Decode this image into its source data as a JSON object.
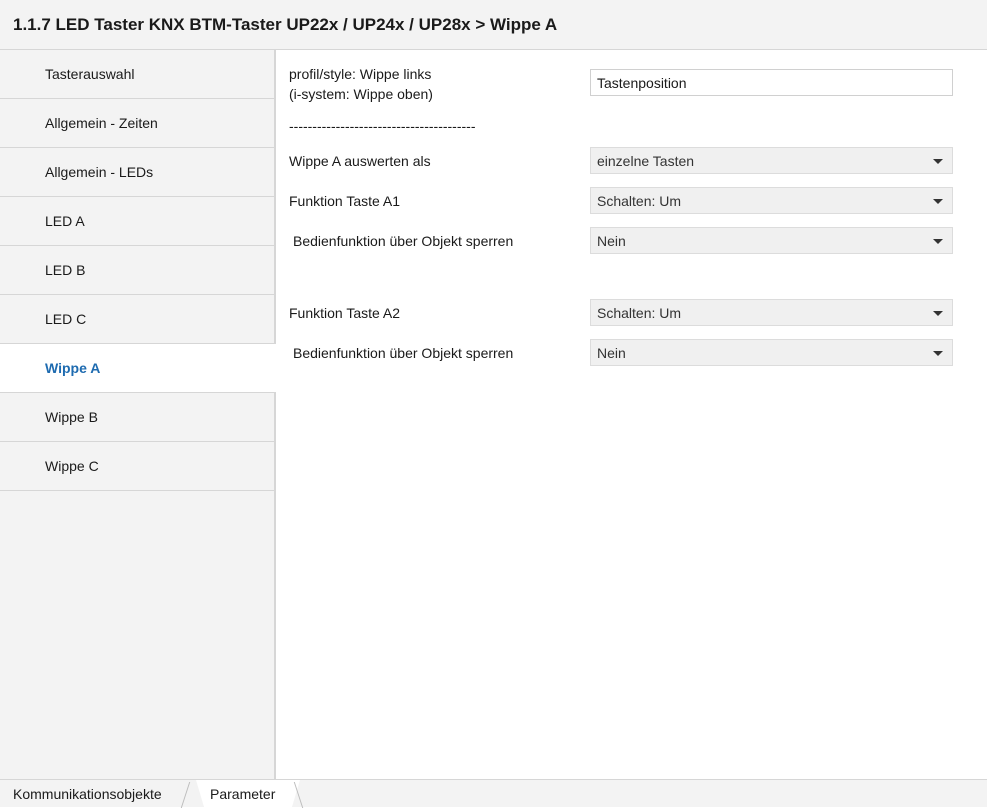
{
  "header": {
    "title": "1.1.7 LED Taster KNX BTM-Taster UP22x / UP24x / UP28x > Wippe A"
  },
  "sidebar": {
    "items": [
      {
        "label": "Tasterauswahl"
      },
      {
        "label": "Allgemein - Zeiten"
      },
      {
        "label": "Allgemein - LEDs"
      },
      {
        "label": "LED A"
      },
      {
        "label": "LED B"
      },
      {
        "label": "LED C"
      },
      {
        "label": "Wippe A"
      },
      {
        "label": "Wippe B"
      },
      {
        "label": "Wippe C"
      }
    ],
    "active": "Wippe A"
  },
  "params": {
    "position_label_line1": "profil/style: Wippe links",
    "position_label_line2": "(i-system: Wippe oben)",
    "position_value": "Tastenposition",
    "separator": "----------------------------------------",
    "auswerten_label": "Wippe A auswerten als",
    "auswerten_value": "einzelne Tasten",
    "a1_label": "Funktion Taste A1",
    "a1_value": "Schalten: Um",
    "a1_sperren_label": "Bedienfunktion über Objekt sperren",
    "a1_sperren_value": "Nein",
    "a2_label": "Funktion Taste A2",
    "a2_value": "Schalten: Um",
    "a2_sperren_label": "Bedienfunktion über Objekt sperren",
    "a2_sperren_value": "Nein"
  },
  "footer": {
    "tabs": [
      {
        "label": "Kommunikationsobjekte"
      },
      {
        "label": "Parameter"
      }
    ],
    "active": "Parameter"
  }
}
